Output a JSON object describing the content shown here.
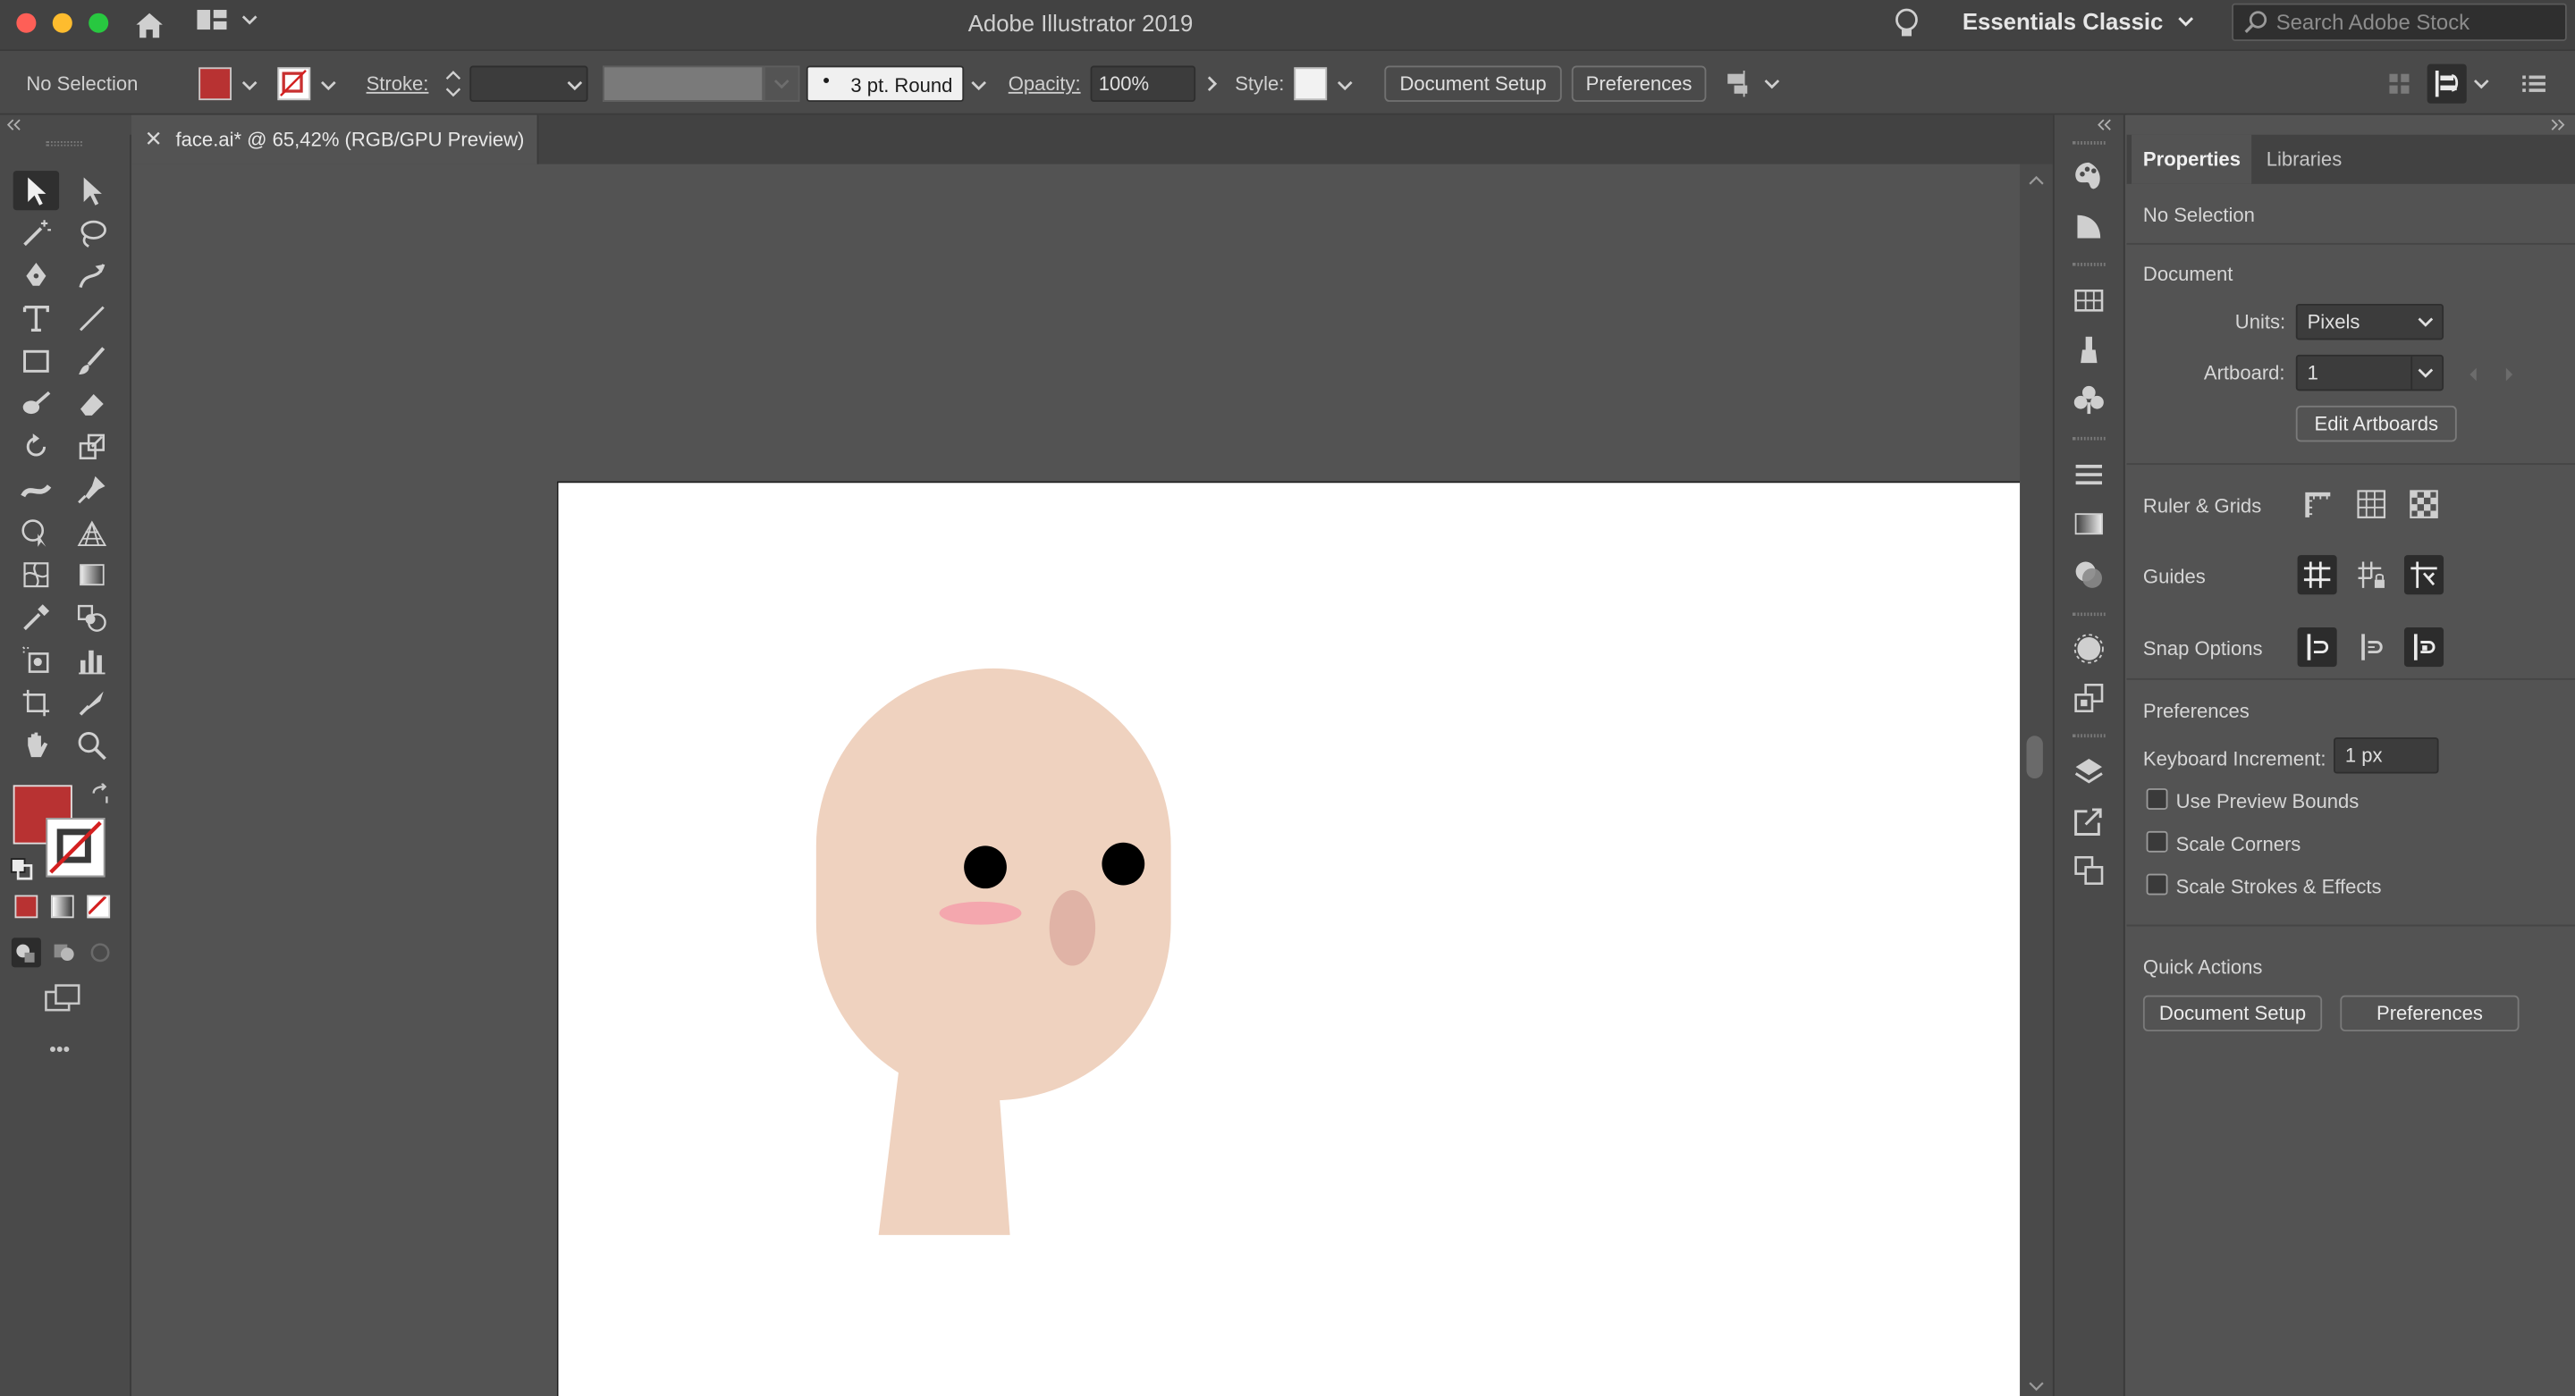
{
  "window": {
    "title": "Adobe Illustrator 2019",
    "workspace": "Essentials Classic",
    "search_placeholder": "Search Adobe Stock",
    "traffic_colors": [
      "#fe5f57",
      "#febc2e",
      "#28c840"
    ]
  },
  "control_bar": {
    "selection_label": "No Selection",
    "stroke_label": "Stroke:",
    "brush_label": "3 pt. Round",
    "opacity_label": "Opacity:",
    "opacity_value": "100%",
    "style_label": "Style:",
    "document_setup": "Document Setup",
    "preferences": "Preferences"
  },
  "document": {
    "tab_close": "✕",
    "tab_title": "face.ai* @ 65,42% (RGB/GPU Preview)"
  },
  "colors": {
    "fill": "#b83232",
    "skin": "#efd2bf",
    "blush": "#f4a7ae",
    "nose": "#e0b3a6",
    "eye": "#000000"
  },
  "properties": {
    "tabs": [
      "Properties",
      "Libraries"
    ],
    "selection": "No Selection",
    "document_heading": "Document",
    "units_label": "Units:",
    "units_value": "Pixels",
    "artboard_label": "Artboard:",
    "artboard_value": "1",
    "edit_artboards": "Edit Artboards",
    "ruler_grids": "Ruler & Grids",
    "guides": "Guides",
    "snap_options": "Snap Options",
    "preferences_heading": "Preferences",
    "keyboard_increment_label": "Keyboard Increment:",
    "keyboard_increment_value": "1 px",
    "use_preview_bounds": "Use Preview Bounds",
    "scale_corners": "Scale Corners",
    "scale_strokes": "Scale Strokes & Effects",
    "quick_actions": "Quick Actions",
    "qa_document_setup": "Document Setup",
    "qa_preferences": "Preferences"
  },
  "toolbar": {
    "more": "•••"
  }
}
